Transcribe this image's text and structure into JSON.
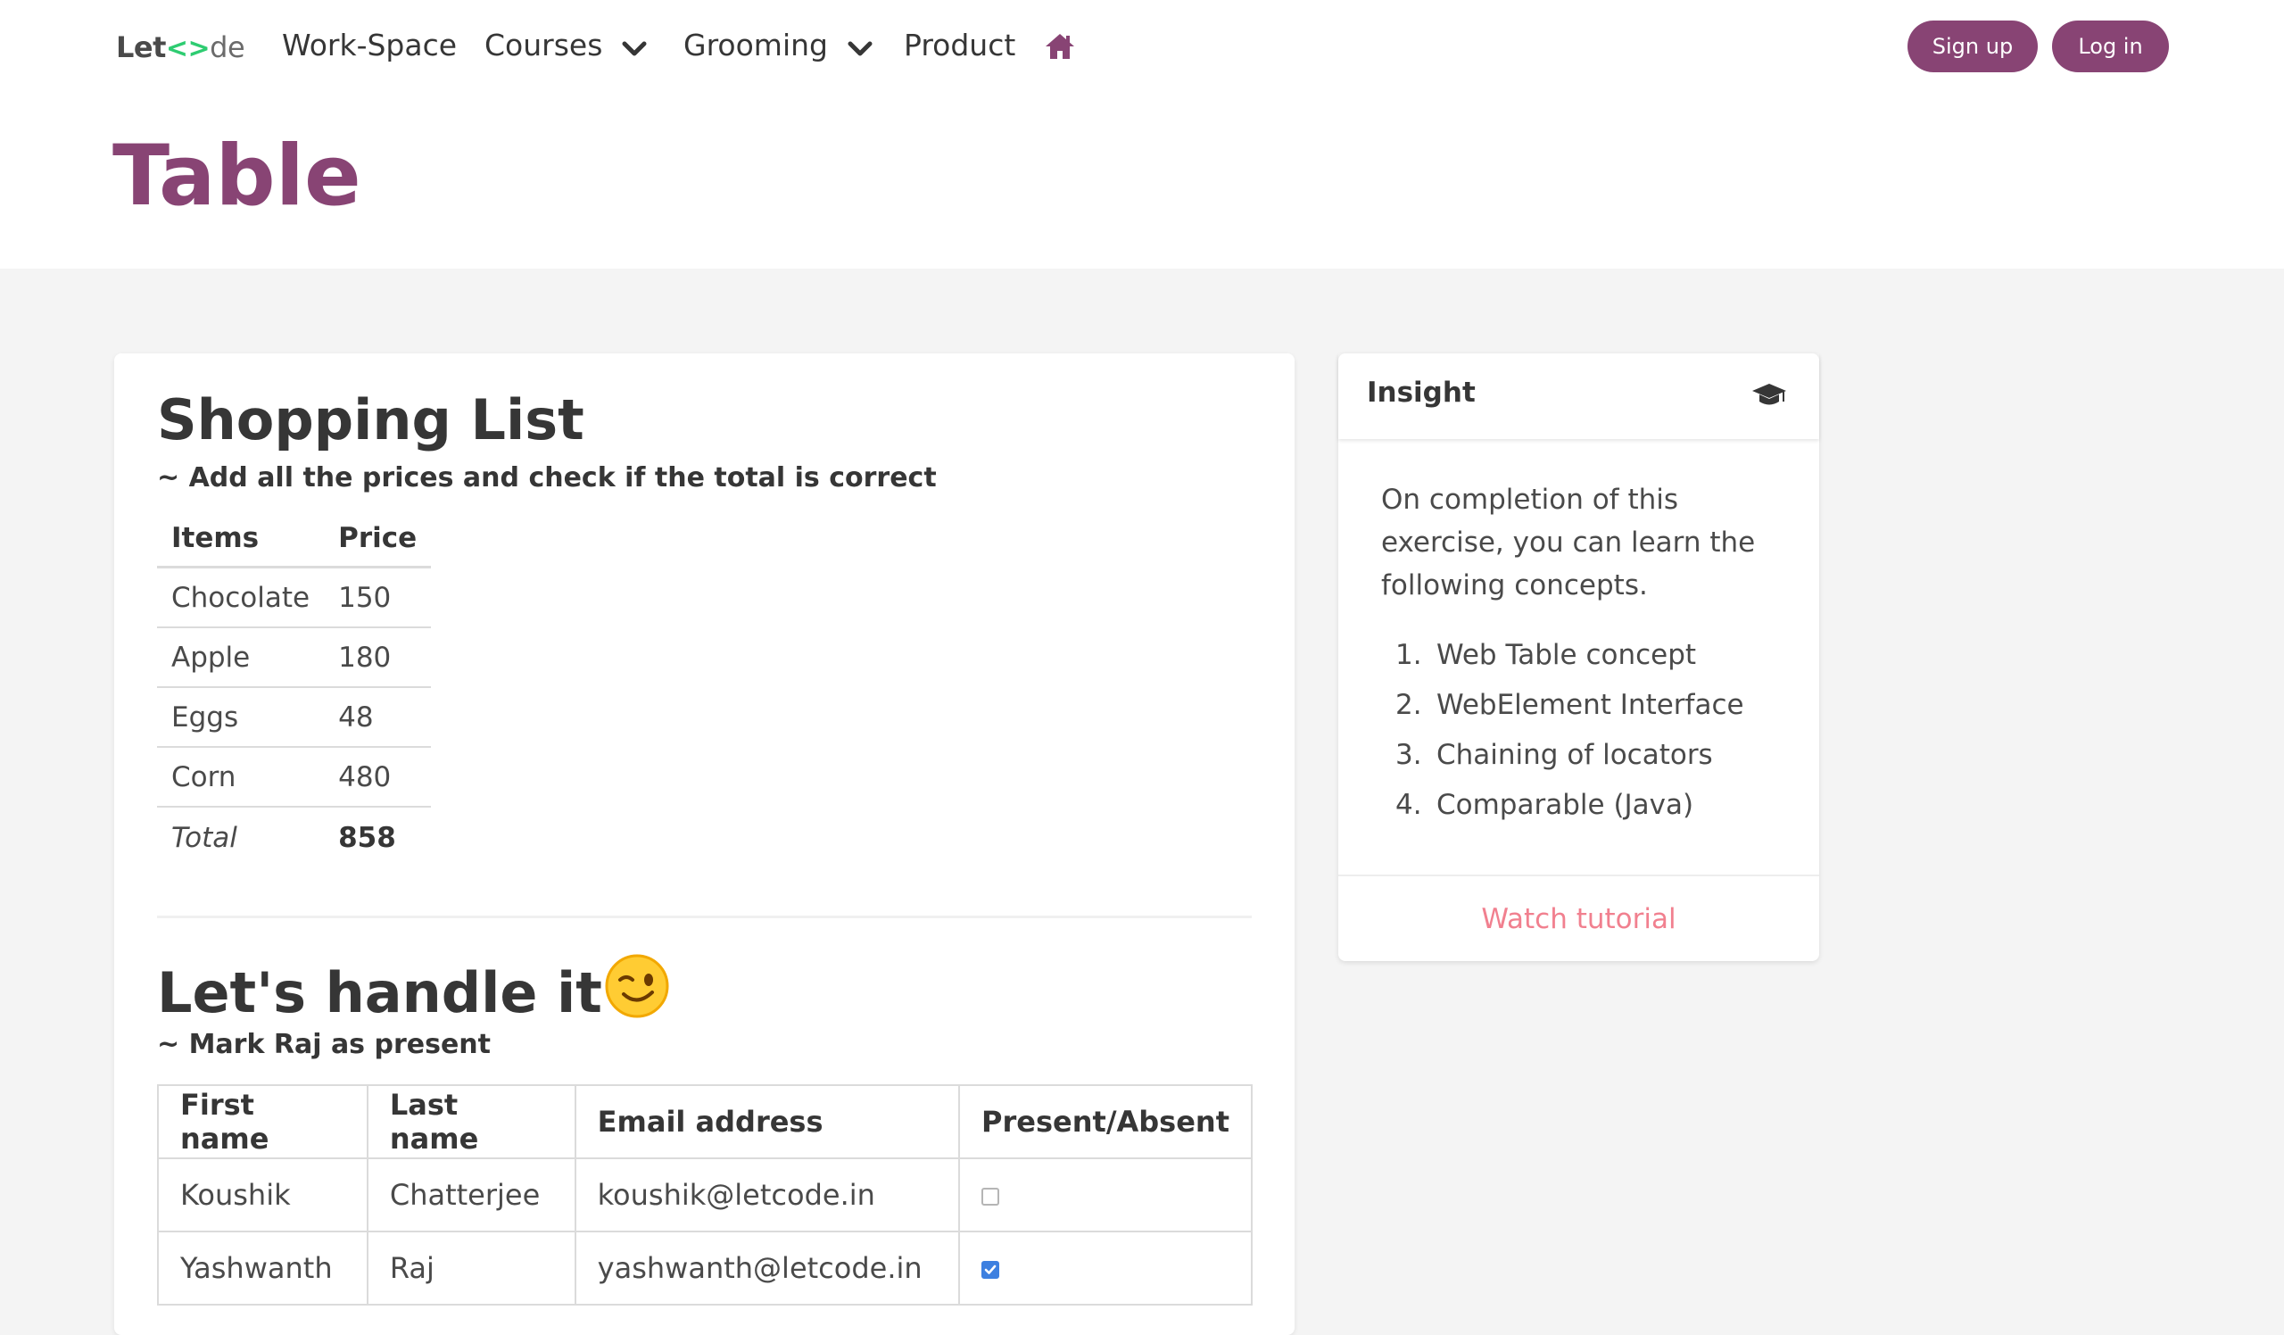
{
  "navbar": {
    "brand": {
      "let": "Let",
      "glyph": "<>",
      "code": "de"
    },
    "items": [
      {
        "label": "Work-Space"
      },
      {
        "label": "Courses"
      },
      {
        "label": "Grooming"
      },
      {
        "label": "Product"
      }
    ],
    "signup_label": "Sign up",
    "login_label": "Log in"
  },
  "hero": {
    "title": "Table"
  },
  "shopping": {
    "title": "Shopping List",
    "subtitle": "~ Add all the prices and check if the total is correct",
    "columns": [
      "Items",
      "Price"
    ],
    "rows": [
      {
        "item": "Chocolate",
        "price": "150"
      },
      {
        "item": "Apple",
        "price": "180"
      },
      {
        "item": "Eggs",
        "price": "48"
      },
      {
        "item": "Corn",
        "price": "480"
      }
    ],
    "total_label": "Total",
    "total_value": "858"
  },
  "handle": {
    "title": "Let's handle it",
    "subtitle": "~ Mark Raj as present",
    "columns": [
      "First name",
      "Last name",
      "Email address",
      "Present/Absent"
    ],
    "rows": [
      {
        "first": "Koushik",
        "last": "Chatterjee",
        "email": "koushik@letcode.in",
        "present": false
      },
      {
        "first": "Yashwanth",
        "last": "Raj",
        "email": "yashwanth@letcode.in",
        "present": true
      }
    ]
  },
  "insight": {
    "title": "Insight",
    "body": "On completion of this exercise, you can learn the following concepts.",
    "concepts": [
      {
        "num": "1.",
        "text": "Web Table concept"
      },
      {
        "num": "2.",
        "text": "WebElement Interface"
      },
      {
        "num": "3.",
        "text": "Chaining of locators"
      },
      {
        "num": "4.",
        "text": "Comparable (Java)"
      }
    ],
    "footer_link": "Watch tutorial"
  },
  "colors": {
    "brand_purple": "#884474",
    "link_pink": "#f1808f",
    "checkbox_blue": "#3d80e0",
    "page_bg": "#f4f4f4"
  },
  "icons": [
    "chevron-down-icon",
    "home-icon",
    "graduation-cap-icon",
    "winking-face-emoji"
  ]
}
